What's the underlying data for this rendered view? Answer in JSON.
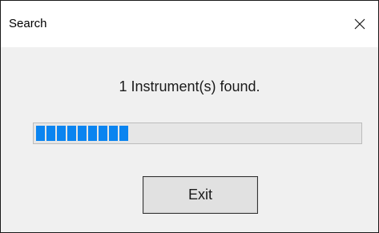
{
  "window": {
    "title": "Search"
  },
  "message": "1 Instrument(s) found.",
  "progress": {
    "value_fraction": 0.41,
    "segments_filled": 9,
    "fill_color": "#0a84f0",
    "track_color": "#e6e6e6"
  },
  "buttons": {
    "exit_label": "Exit"
  },
  "icons": {
    "close": "close-icon"
  }
}
